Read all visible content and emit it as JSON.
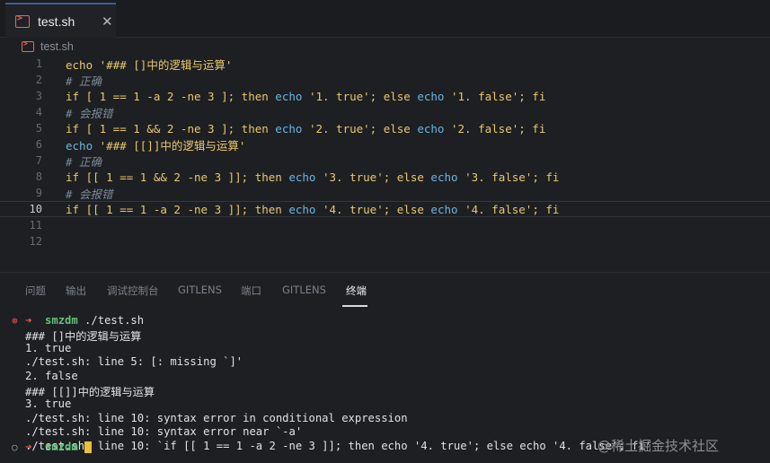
{
  "tab": {
    "title": "test.sh",
    "close_glyph": "✕"
  },
  "breadcrumb": {
    "file": "test.sh"
  },
  "editor": {
    "active_line": 10,
    "lines": [
      {
        "n": "1",
        "type": "code",
        "parts": [
          [
            "kw",
            "echo "
          ],
          [
            "kw",
            "'### []中的逻辑与运算'"
          ]
        ]
      },
      {
        "n": "2",
        "type": "comment",
        "parts": [
          [
            "comment",
            "# 正确"
          ]
        ]
      },
      {
        "n": "3",
        "type": "code",
        "parts": [
          [
            "kw",
            "if [ 1 == 1 -a 2 -ne 3 ]; then "
          ],
          [
            "cmd",
            "echo "
          ],
          [
            "kw",
            "'1. true'; else "
          ],
          [
            "cmd",
            "echo "
          ],
          [
            "kw",
            "'1. false'; fi"
          ]
        ]
      },
      {
        "n": "4",
        "type": "comment",
        "parts": [
          [
            "comment",
            "# 会报错"
          ]
        ]
      },
      {
        "n": "5",
        "type": "code",
        "parts": [
          [
            "kw",
            "if [ 1 == 1 && 2 -ne 3 ]; then "
          ],
          [
            "cmd",
            "echo "
          ],
          [
            "kw",
            "'2. true'; else "
          ],
          [
            "cmd",
            "echo "
          ],
          [
            "kw",
            "'2. false'; fi"
          ]
        ]
      },
      {
        "n": "6",
        "type": "code",
        "parts": [
          [
            "cmd",
            "echo "
          ],
          [
            "kw",
            "'### [[]]中的逻辑与运算'"
          ]
        ]
      },
      {
        "n": "7",
        "type": "comment",
        "parts": [
          [
            "comment",
            "# 正确"
          ]
        ]
      },
      {
        "n": "8",
        "type": "code",
        "parts": [
          [
            "kw",
            "if [[ 1 == 1 && 2 -ne 3 ]]; then "
          ],
          [
            "cmd",
            "echo "
          ],
          [
            "kw",
            "'3. true'; else "
          ],
          [
            "cmd",
            "echo "
          ],
          [
            "kw",
            "'3. false'; fi"
          ]
        ]
      },
      {
        "n": "9",
        "type": "comment",
        "parts": [
          [
            "comment",
            "# 会报错"
          ]
        ]
      },
      {
        "n": "10",
        "type": "code",
        "parts": [
          [
            "kw",
            "if [[ 1 == 1 -a 2 -ne 3 ]]; then "
          ],
          [
            "cmd",
            "echo "
          ],
          [
            "kw",
            "'4. true'; else "
          ],
          [
            "cmd",
            "echo "
          ],
          [
            "kw",
            "'4. false'; fi"
          ]
        ]
      },
      {
        "n": "11",
        "type": "empty",
        "parts": []
      },
      {
        "n": "12",
        "type": "empty",
        "parts": []
      }
    ]
  },
  "panel": {
    "tabs": [
      "问题",
      "输出",
      "调试控制台",
      "GITLENS",
      "端口",
      "GITLENS",
      "终端"
    ],
    "active_tab": "终端"
  },
  "terminal": {
    "user": "smzdm",
    "arrow": "➜",
    "first_command": " ./test.sh",
    "output": [
      "### []中的逻辑与运算",
      "1. true",
      "./test.sh: line 5: [: missing `]'",
      "2. false",
      "### [[]]中的逻辑与运算",
      "3. true",
      "./test.sh: line 10: syntax error in conditional expression",
      "./test.sh: line 10: syntax error near `-a'",
      "./test.sh: line 10: `if [[ 1 == 1 -a 2 -ne 3 ]]; then echo '4. true'; else echo '4. false'; fi'"
    ],
    "status_error_glyph": "⊗",
    "status_idle_glyph": "○"
  },
  "watermark": "@稀土掘金技术社区",
  "colors": {
    "keyword": "#e6c96e",
    "command": "#69b6e3",
    "comment": "#7a8a99",
    "prompt_user": "#63c178",
    "prompt_arrow": "#e05c4f",
    "cursor": "#e8c23a"
  }
}
